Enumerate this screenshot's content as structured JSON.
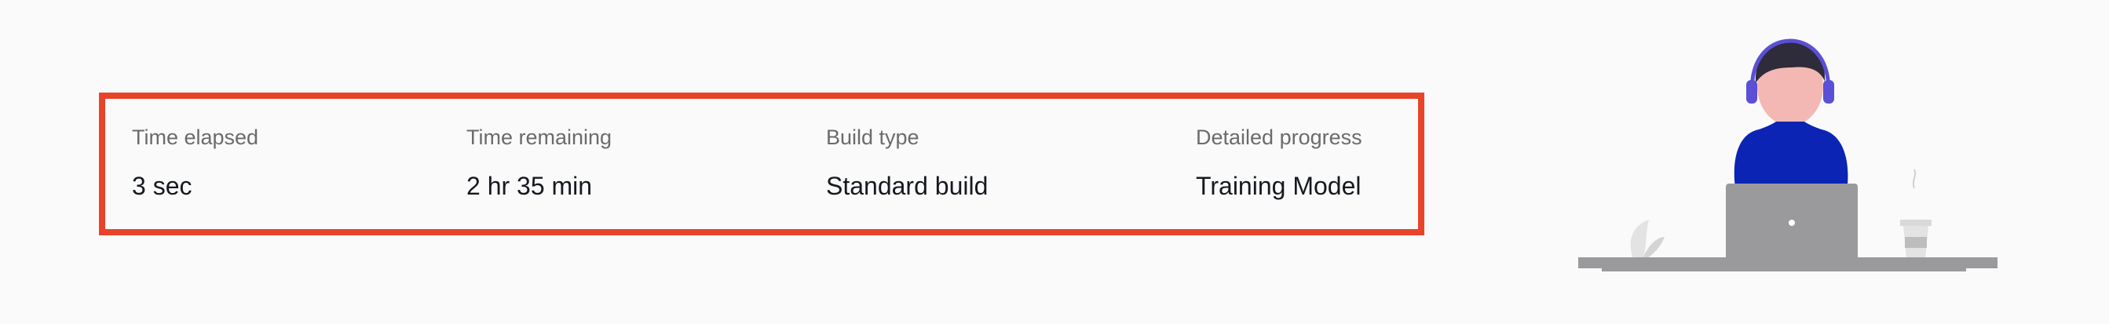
{
  "stats": [
    {
      "label": "Time elapsed",
      "value": "3 sec"
    },
    {
      "label": "Time remaining",
      "value": "2 hr 35 min"
    },
    {
      "label": "Build type",
      "value": "Standard build"
    },
    {
      "label": "Detailed progress",
      "value": "Training Model"
    }
  ],
  "colors": {
    "highlight_border": "#e8442b",
    "background": "#fafafa",
    "label_text": "#6b6b6b",
    "value_text": "#16191f",
    "shirt": "#0b24b3",
    "headphones": "#5b4fd6",
    "laptop": "#9a9a9c"
  },
  "illustration": {
    "icon": "person-at-laptop-illustration"
  }
}
